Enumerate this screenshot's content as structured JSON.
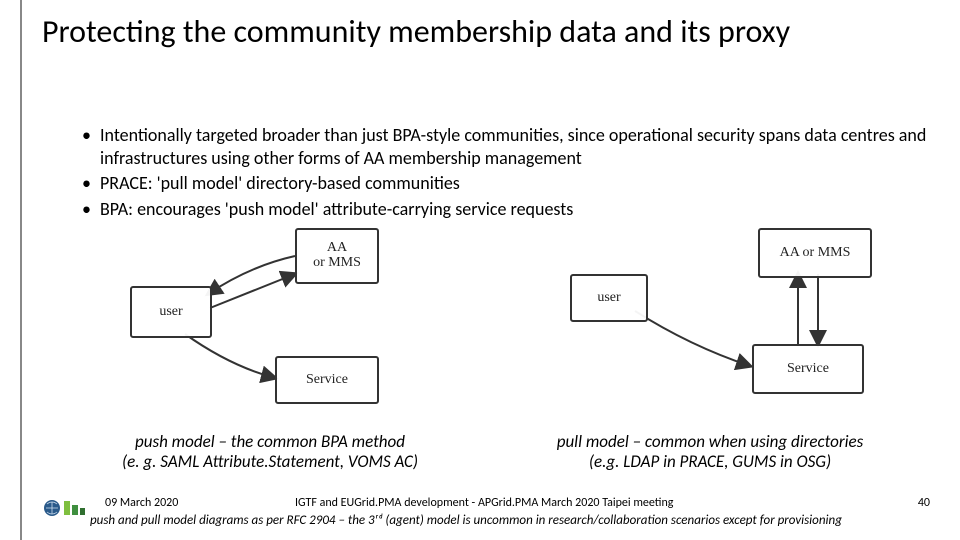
{
  "title": "Protecting the community membership data and its proxy",
  "bullets": [
    "Intentionally targeted broader than just BPA-style communities, since operational security spans data centres and infrastructures using other forms of AA membership management",
    "PRACE: 'pull model' directory-based communities",
    "BPA: encourages 'push model' attribute-carrying service requests"
  ],
  "diagram_left": {
    "user": "user",
    "aa": "AA\nor MMS",
    "service": "Service"
  },
  "diagram_right": {
    "user": "user",
    "aa": "AA or MMS",
    "service": "Service"
  },
  "caption_left_1": "push model – the common BPA method",
  "caption_left_2": "(e. g. SAML Attribute.Statement, VOMS AC)",
  "caption_right_1": "pull model – common when using directories",
  "caption_right_2": "(e.g. LDAP in PRACE, GUMS in OSG)",
  "footer": {
    "date": "09 March 2020",
    "center": "IGTF and EUGrid.PMA development - APGrid.PMA March 2020 Taipei meeting",
    "page": "40",
    "note": "push and pull model diagrams as per RFC 2904 – the 3ʳᵈ (agent) model is uncommon in research/collaboration scenarios except for provisioning"
  }
}
